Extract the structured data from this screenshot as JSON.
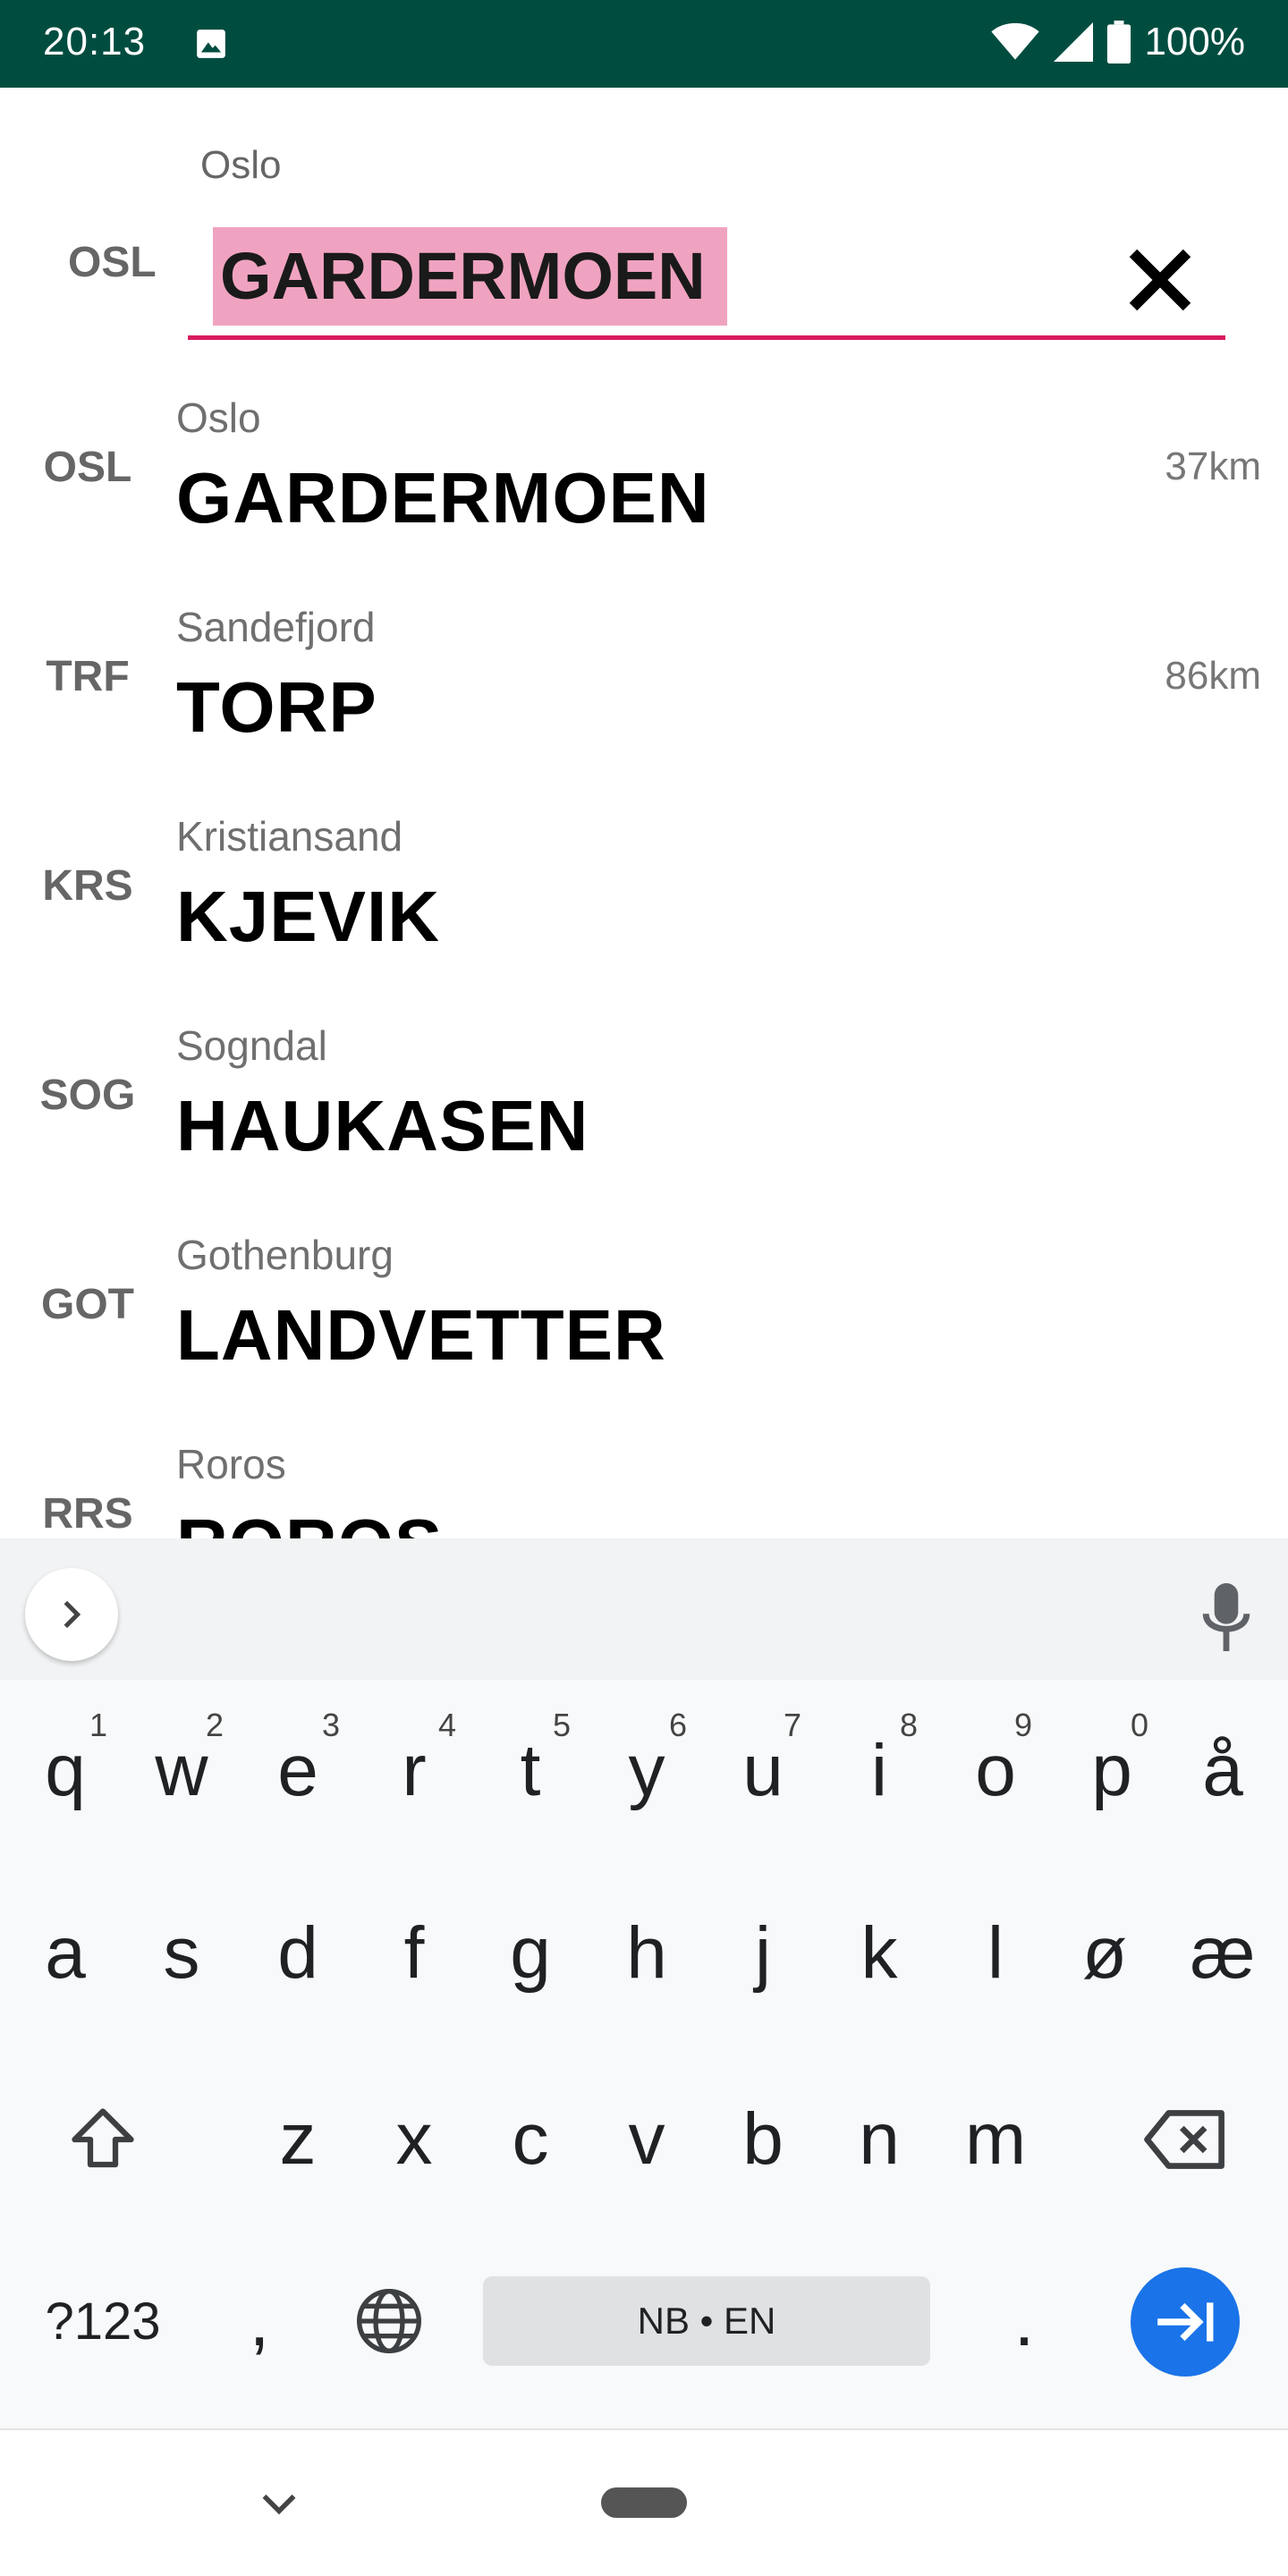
{
  "status_bar": {
    "time": "20:13",
    "battery": "100%",
    "icons": [
      "image-icon",
      "wifi-icon",
      "signal-icon",
      "battery-icon"
    ],
    "background": "#004d40"
  },
  "search": {
    "city": "Oslo",
    "code": "OSL",
    "value": "GARDERMOEN",
    "highlight_color": "#f0a3c0",
    "underline_color": "#d81b60"
  },
  "results": [
    {
      "code": "OSL",
      "city": "Oslo",
      "name": "GARDERMOEN",
      "distance": "37km"
    },
    {
      "code": "TRF",
      "city": "Sandefjord",
      "name": "TORP",
      "distance": "86km"
    },
    {
      "code": "KRS",
      "city": "Kristiansand",
      "name": "KJEVIK",
      "distance": ""
    },
    {
      "code": "SOG",
      "city": "Sogndal",
      "name": "HAUKASEN",
      "distance": ""
    },
    {
      "code": "GOT",
      "city": "Gothenburg",
      "name": "LANDVETTER",
      "distance": ""
    },
    {
      "code": "RRS",
      "city": "Roros",
      "name": "ROROS",
      "distance": ""
    }
  ],
  "keyboard": {
    "row1": [
      "q",
      "w",
      "e",
      "r",
      "t",
      "y",
      "u",
      "i",
      "o",
      "p",
      "å"
    ],
    "row1_hints": [
      "1",
      "2",
      "3",
      "4",
      "5",
      "6",
      "7",
      "8",
      "9",
      "0"
    ],
    "row2": [
      "a",
      "s",
      "d",
      "f",
      "g",
      "h",
      "j",
      "k",
      "l",
      "ø",
      "æ"
    ],
    "row3": [
      "z",
      "x",
      "c",
      "v",
      "b",
      "n",
      "m"
    ],
    "symbols_label": "?123",
    "comma": ",",
    "space_label": "NB • EN",
    "period": ".",
    "enter_color": "#1a73e8"
  }
}
